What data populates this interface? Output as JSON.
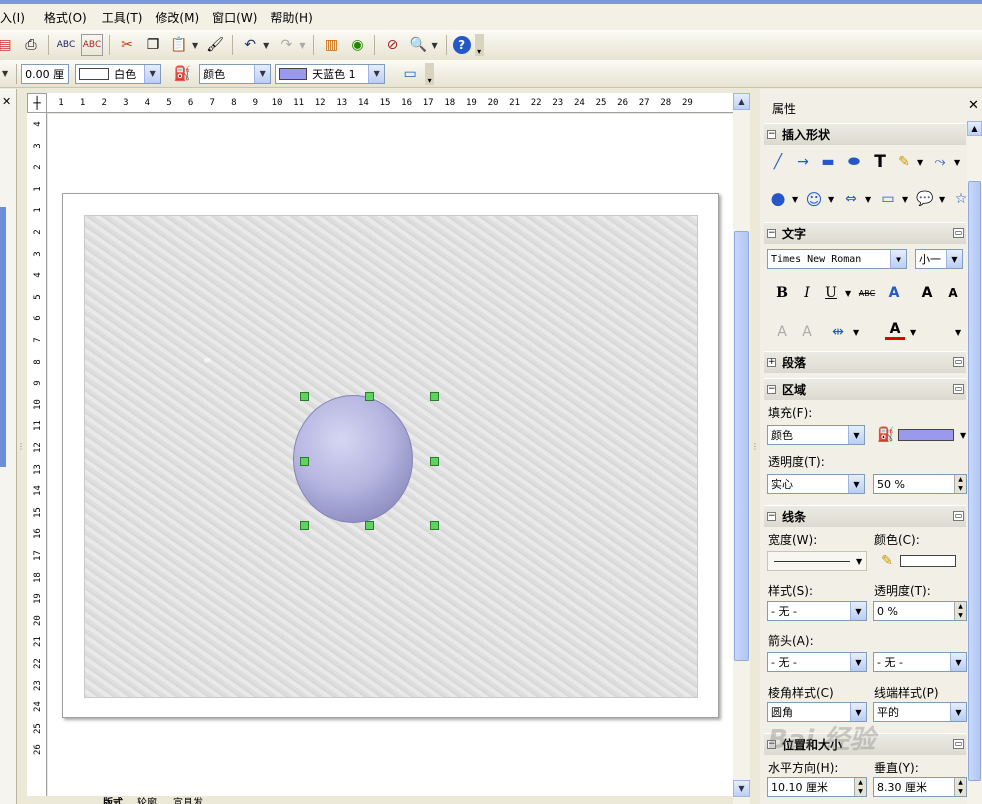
{
  "menu": [
    "入(I)",
    "格式(O)",
    "工具(T)",
    "修改(M)",
    "窗口(W)",
    "帮助(H)"
  ],
  "toolbar2": {
    "line_width": "0.00 厘",
    "line_color": "白色",
    "area_style": "颜色",
    "area_color": "天蓝色 1",
    "line_swatch": "#ffffff",
    "area_swatch": "#9999ee"
  },
  "ruler": {
    "h": [
      "1",
      "1",
      "2",
      "3",
      "4",
      "5",
      "6",
      "7",
      "8",
      "9",
      "10",
      "11",
      "12",
      "13",
      "14",
      "15",
      "16",
      "17",
      "18",
      "19",
      "20",
      "21",
      "22",
      "23",
      "24",
      "25",
      "26",
      "27",
      "28",
      "29"
    ],
    "v": [
      "4",
      "3",
      "2",
      "1",
      "1",
      "2",
      "3",
      "4",
      "5",
      "6",
      "7",
      "8",
      "9",
      "10",
      "11",
      "12",
      "13",
      "14",
      "15",
      "16",
      "17",
      "18",
      "19",
      "20",
      "21",
      "22",
      "23",
      "24",
      "25",
      "26"
    ]
  },
  "bottom_tabs": [
    "版式",
    "轮廓",
    "宣具发"
  ],
  "sidebar": {
    "title": "属性",
    "sections": {
      "insert_shapes": "插入形状",
      "text": "文字",
      "paragraph": "段落",
      "area": "区域",
      "line": "线条",
      "position_size": "位置和大小"
    },
    "text": {
      "font": "Times New Roman",
      "size": "小一"
    },
    "area": {
      "fill_label": "填充(F):",
      "fill_value": "颜色",
      "fill_color": "#9999ee",
      "transparency_label": "透明度(T):",
      "transparency_mode": "实心",
      "transparency_value": "50 %"
    },
    "line": {
      "width_label": "宽度(W):",
      "color_label": "颜色(C):",
      "style_label": "样式(S):",
      "style_value": "- 无 -",
      "transparency_label": "透明度(T):",
      "transparency_value": "0 %",
      "arrow_label": "箭头(A):",
      "arrow_start": "- 无 -",
      "arrow_end": "- 无 -",
      "corner_label": "棱角样式(C)",
      "corner_value": "圆角",
      "cap_label": "线端样式(P)",
      "cap_value": "平的"
    },
    "position": {
      "h_label": "水平方向(H):",
      "h_value": "10.10 厘米",
      "v_label": "垂直(Y):",
      "v_value": "8.30 厘米"
    }
  },
  "shape": {
    "fill_color": "#b5b5e0"
  },
  "watermark": "Bai 经验"
}
